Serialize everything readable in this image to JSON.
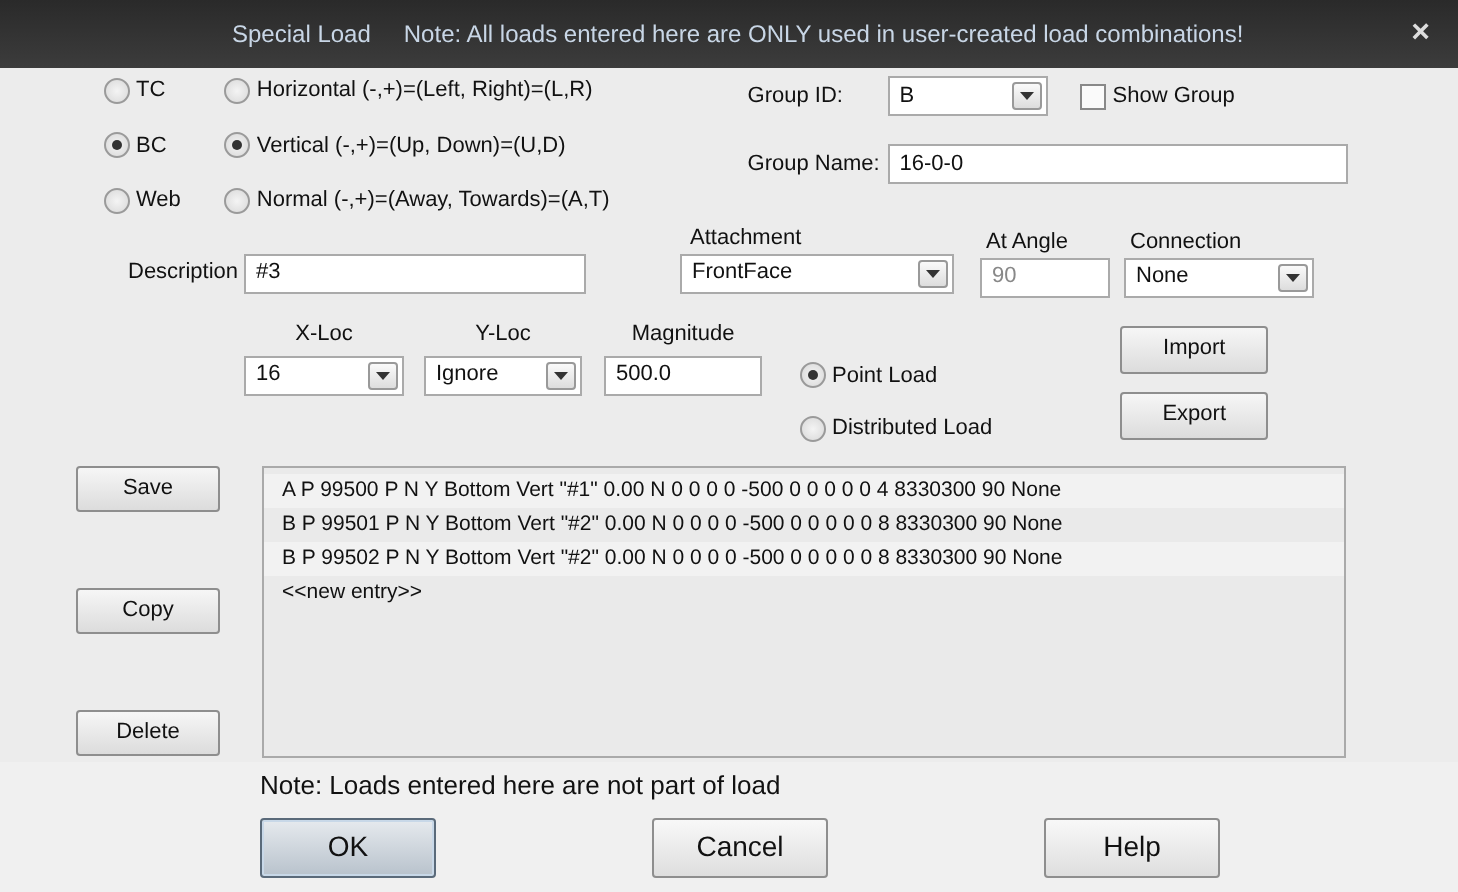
{
  "window": {
    "title": "Special Load",
    "note": "Note: All loads entered here are ONLY used in user-created load combinations!",
    "close": "×"
  },
  "member_options": [
    {
      "label": "TC",
      "selected": false
    },
    {
      "label": "BC",
      "selected": true
    },
    {
      "label": "Web",
      "selected": false
    }
  ],
  "direction_options": [
    {
      "label": "Horizontal (-,+)=(Left, Right)=(L,R)",
      "selected": false
    },
    {
      "label": "Vertical (-,+)=(Up, Down)=(U,D)",
      "selected": true
    },
    {
      "label": "Normal (-,+)=(Away, Towards)=(A,T)",
      "selected": false
    }
  ],
  "group_id": {
    "label": "Group ID:",
    "value": "B"
  },
  "show_group": {
    "label": "Show Group",
    "checked": false
  },
  "group_name": {
    "label": "Group Name:",
    "value": "16-0-0"
  },
  "description": {
    "label": "Description",
    "value": "#3"
  },
  "attachment": {
    "label": "Attachment",
    "value": "FrontFace"
  },
  "at_angle": {
    "label": "At Angle",
    "value": "90",
    "disabled": true
  },
  "connection": {
    "label": "Connection",
    "value": "None"
  },
  "x_loc": {
    "label": "X-Loc",
    "value": "16"
  },
  "y_loc": {
    "label": "Y-Loc",
    "value": "Ignore"
  },
  "magnitude": {
    "label": "Magnitude",
    "value": "500.0"
  },
  "load_type_options": [
    {
      "label": "Point Load",
      "selected": true
    },
    {
      "label": "Distributed Load",
      "selected": false
    }
  ],
  "transfer_buttons": [
    "Import",
    "Export"
  ],
  "entry_buttons": [
    "Save",
    "Copy",
    "Delete"
  ],
  "entries": [
    "A P 99500 P N Y Bottom Vert \"#1\" 0.00 N 0 0 0 0 -500 0 0 0 0 0 4 8330300 90 None",
    "B P 99501 P N Y Bottom Vert \"#2\" 0.00 N 0 0 0 0 -500 0 0 0 0 0 8 8330300 90 None",
    "B P 99502 P N Y Bottom Vert \"#2\" 0.00 N 0 0 0 0 -500 0 0 0 0 0 8 8330300 90 None",
    "<<new entry>>"
  ],
  "footer_note": "Note: Loads entered here are not part of load",
  "dialog_buttons": [
    {
      "label": "OK",
      "default": true
    },
    {
      "label": "Cancel",
      "default": false
    },
    {
      "label": "Help",
      "default": false
    }
  ]
}
